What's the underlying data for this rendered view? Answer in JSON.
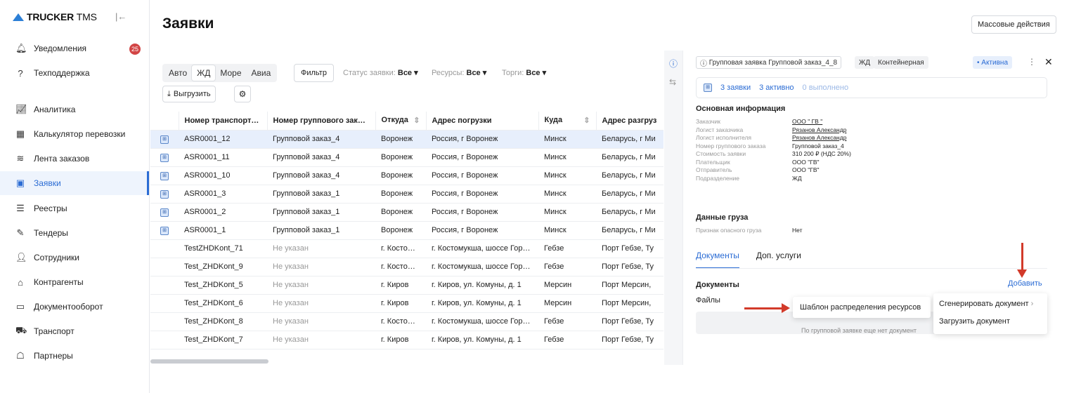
{
  "app": {
    "brand_bold": "TRUCKER",
    "brand_light": "TMS"
  },
  "sidebar": {
    "items": [
      {
        "label": "Уведомления",
        "icon": "bell-icon",
        "badge": "25"
      },
      {
        "label": "Техподдержка",
        "icon": "help-icon"
      },
      {
        "label": "Аналитика",
        "icon": "chart-icon"
      },
      {
        "label": "Калькулятор перевозки",
        "icon": "calculator-icon"
      },
      {
        "label": "Лента заказов",
        "icon": "feed-icon"
      },
      {
        "label": "Заявки",
        "icon": "requests-icon",
        "active": true
      },
      {
        "label": "Реестры",
        "icon": "registry-icon"
      },
      {
        "label": "Тендеры",
        "icon": "tender-icon"
      },
      {
        "label": "Сотрудники",
        "icon": "person-icon"
      },
      {
        "label": "Контрагенты",
        "icon": "bank-icon"
      },
      {
        "label": "Документооборот",
        "icon": "document-icon"
      },
      {
        "label": "Транспорт",
        "icon": "truck-icon"
      },
      {
        "label": "Партнеры",
        "icon": "partners-icon"
      }
    ]
  },
  "header": {
    "title": "Заявки",
    "mass_actions": "Массовые действия"
  },
  "filters": {
    "modes": [
      "Авто",
      "ЖД",
      "Море",
      "Авиа"
    ],
    "active_mode": "ЖД",
    "filter_label": "Фильтр",
    "status_label": "Статус заявки:",
    "status_value": "Все",
    "resources_label": "Ресурсы:",
    "resources_value": "Все",
    "auctions_label": "Торги:",
    "auctions_value": "Все",
    "export_label": "Выгрузить"
  },
  "table": {
    "columns": [
      "Номер транспорти…",
      "Номер группового заказа",
      "Откуда",
      "Адрес погрузки",
      "Куда",
      "Адрес разгруз"
    ],
    "rows": [
      {
        "icon": true,
        "selected": true,
        "c": [
          "ASR0001_12",
          "Групповой заказ_4",
          "Воронеж",
          "Россия, г Воронеж",
          "Минск",
          "Беларусь, г Ми"
        ]
      },
      {
        "icon": true,
        "c": [
          "ASR0001_11",
          "Групповой заказ_4",
          "Воронеж",
          "Россия, г Воронеж",
          "Минск",
          "Беларусь, г Ми"
        ]
      },
      {
        "icon": true,
        "c": [
          "ASR0001_10",
          "Групповой заказ_4",
          "Воронеж",
          "Россия, г Воронеж",
          "Минск",
          "Беларусь, г Ми"
        ]
      },
      {
        "icon": true,
        "c": [
          "ASR0001_3",
          "Групповой заказ_1",
          "Воронеж",
          "Россия, г Воронеж",
          "Минск",
          "Беларусь, г Ми"
        ]
      },
      {
        "icon": true,
        "c": [
          "ASR0001_2",
          "Групповой заказ_1",
          "Воронеж",
          "Россия, г Воронеж",
          "Минск",
          "Беларусь, г Ми"
        ]
      },
      {
        "icon": true,
        "c": [
          "ASR0001_1",
          "Групповой заказ_1",
          "Воронеж",
          "Россия, г Воронеж",
          "Минск",
          "Беларусь, г Ми"
        ]
      },
      {
        "icon": false,
        "muted": true,
        "c": [
          "TestZHDKont_71",
          "Не указан",
          "г. Косто…",
          "г. Костомукша, шоссе Гор…",
          "Гебзе",
          "Порт Гебзе, Ту"
        ]
      },
      {
        "icon": false,
        "muted": true,
        "c": [
          "Test_ZHDKont_9",
          "Не указан",
          "г. Косто…",
          "г. Костомукша, шоссе Гор…",
          "Гебзе",
          "Порт Гебзе, Ту"
        ]
      },
      {
        "icon": false,
        "muted": true,
        "c": [
          "Test_ZHDKont_5",
          "Не указан",
          "г. Киров",
          "г. Киров, ул. Комуны, д. 1",
          "Мерсин",
          "Порт Мерсин, "
        ]
      },
      {
        "icon": false,
        "muted": true,
        "c": [
          "Test_ZHDKont_6",
          "Не указан",
          "г. Киров",
          "г. Киров, ул. Комуны, д. 1",
          "Мерсин",
          "Порт Мерсин, "
        ]
      },
      {
        "icon": false,
        "muted": true,
        "c": [
          "Test_ZHDKont_8",
          "Не указан",
          "г. Косто…",
          "г. Костомукша, шоссе Гор…",
          "Гебзе",
          "Порт Гебзе, Ту"
        ]
      },
      {
        "icon": false,
        "muted": true,
        "c": [
          "Test_ZHDKont_7",
          "Не указан",
          "г. Киров",
          "г. Киров, ул. Комуны, д. 1",
          "Гебзе",
          "Порт Гебзе, Ту"
        ]
      }
    ]
  },
  "panel": {
    "group_chip": "Групповая заявка Групповой заказ_4_8",
    "type_chip": "ЖД",
    "container_chip": "Контейнерная",
    "status_chip": "• Активна",
    "stats": {
      "requests": "3 заявки",
      "active": "3 активно",
      "done": "0 выполнено"
    },
    "main_info_title": "Основная информация",
    "main_info": [
      {
        "k": "Заказчик",
        "v": "ООО \" ГВ \"",
        "link": true
      },
      {
        "k": "Логист заказчика",
        "v": "Рязанов Александр",
        "link": true
      },
      {
        "k": "Логист исполнителя",
        "v": "Рязанов Александр",
        "link": true
      },
      {
        "k": "Номер группового заказа",
        "v": "Групповой заказ_4"
      },
      {
        "k": "Стоимость заявки",
        "v": "310 200 ₽ (НДС 20%)"
      },
      {
        "k": "Плательщик",
        "v": "ООО \"ГВ\""
      },
      {
        "k": "Отправитель",
        "v": "ООО \"ГВ\""
      },
      {
        "k": "Подразделение",
        "v": "ЖД"
      }
    ],
    "cargo_title": "Данные груза",
    "cargo": [
      {
        "k": "Признак опасного груза",
        "v": "Нет"
      }
    ],
    "tabs": [
      "Документы",
      "Доп. услуги"
    ],
    "docs_title": "Документы",
    "add_label": "Добавить",
    "files_label": "Файлы",
    "empty_text": "По групповой заявке еще нет документ"
  },
  "menu": {
    "template_item": "Шаблон распределения ресурсов",
    "generate_item": "Сгенерировать документ",
    "upload_item": "Загрузить документ"
  },
  "colors": {
    "accent": "#2b6cd4",
    "annotation_arrow": "#d23a2a",
    "badge": "#d24545"
  }
}
